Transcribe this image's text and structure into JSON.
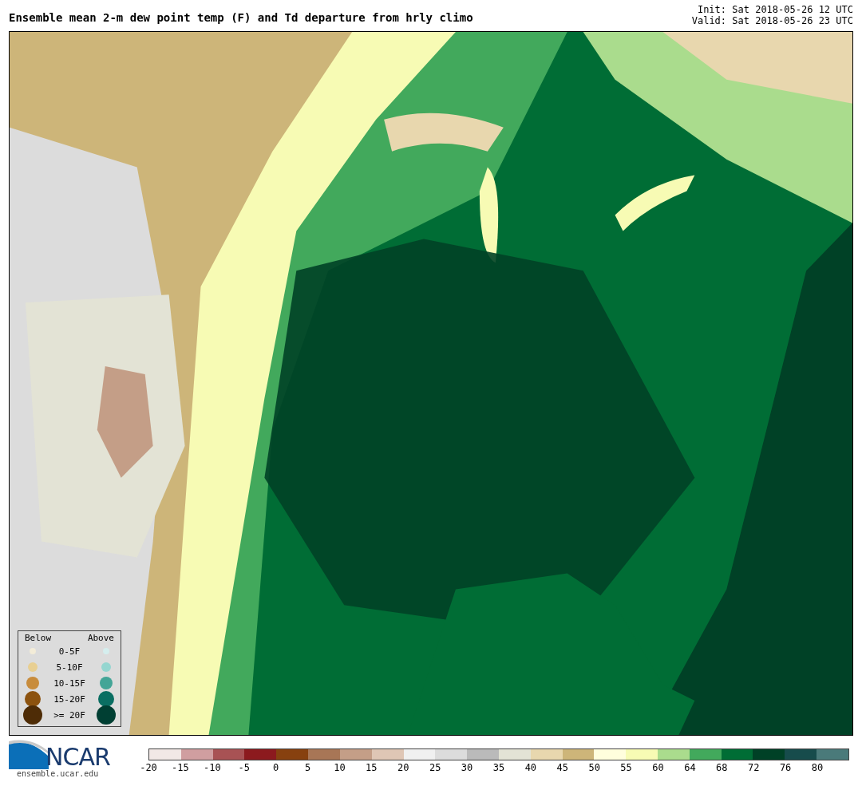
{
  "title": "Ensemble mean 2-m dew point temp (F) and Td departure from hrly climo",
  "init": "Init: Sat 2018-05-26 12 UTC",
  "valid": "Valid: Sat 2018-05-26 23 UTC",
  "legend": {
    "below_label": "Below",
    "above_label": "Above",
    "rows": [
      {
        "label": "0-5F",
        "below": {
          "color": "#f3ecd8"
        },
        "above": {
          "color": "#d5eeee"
        }
      },
      {
        "label": "5-10F",
        "below": {
          "color": "#e8cf92"
        },
        "above": {
          "color": "#95d6d0"
        }
      },
      {
        "label": "10-15F",
        "below": {
          "color": "#c88c3c"
        },
        "above": {
          "color": "#43a597"
        }
      },
      {
        "label": "15-20F",
        "below": {
          "color": "#8c520e"
        },
        "above": {
          "color": "#0a6e62"
        }
      },
      {
        "label": ">= 20F",
        "below": {
          "color": "#4e2c06"
        },
        "above": {
          "color": "#003f33"
        }
      }
    ]
  },
  "logo": {
    "text": "NCAR",
    "url": "ensemble.ucar.edu"
  },
  "colorbar": [
    {
      "label": "-20",
      "color": "#f2e8e6"
    },
    {
      "label": "-15",
      "color": "#d09ea0"
    },
    {
      "label": "-10",
      "color": "#a85254"
    },
    {
      "label": "-5",
      "color": "#8c1a1e"
    },
    {
      "label": "0",
      "color": "#87410f"
    },
    {
      "label": "5",
      "color": "#a87656"
    },
    {
      "label": "10",
      "color": "#c49e87"
    },
    {
      "label": "15",
      "color": "#dfc6b5"
    },
    {
      "label": "20",
      "color": "#f0f0f0"
    },
    {
      "label": "25",
      "color": "#dcdcdc"
    },
    {
      "label": "30",
      "color": "#bababa"
    },
    {
      "label": "35",
      "color": "#e3e3d5"
    },
    {
      "label": "40",
      "color": "#e8d7ae"
    },
    {
      "label": "45",
      "color": "#cdb579"
    },
    {
      "label": "50",
      "color": "#fffedd"
    },
    {
      "label": "55",
      "color": "#f7fbb4"
    },
    {
      "label": "60",
      "color": "#aadc8d"
    },
    {
      "label": "64",
      "color": "#42a95c"
    },
    {
      "label": "68",
      "color": "#006d35"
    },
    {
      "label": "72",
      "color": "#004126"
    },
    {
      "label": "76",
      "color": "#174c4c"
    },
    {
      "label": "80",
      "color": "#4a7a7a"
    }
  ]
}
